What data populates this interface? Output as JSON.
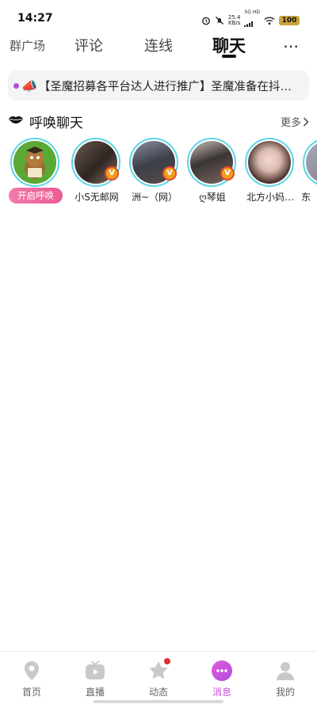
{
  "status_bar": {
    "time": "14:27",
    "speed_value": "25.4",
    "speed_unit": "KB/s",
    "network": "5G HD",
    "battery": "100"
  },
  "top_tabs": {
    "group_square": "群广场",
    "comments": "评论",
    "connect": "连线",
    "chat": "聊天",
    "active": "聊天"
  },
  "notice": {
    "text": "【圣魔招募各平台达人进行推广】圣魔准备在抖…"
  },
  "summon": {
    "title": "呼唤聊天",
    "more": "更多",
    "open_button": "开启呼唤",
    "users": [
      {
        "name": "小S无邮网",
        "vip": "V"
      },
      {
        "name": "洲~（网）",
        "vip": "V"
      },
      {
        "name": "ღ琴姐",
        "vip": "V"
      },
      {
        "name": "北方小妈…",
        "vip": ""
      },
      {
        "name": "东",
        "vip": ""
      }
    ]
  },
  "bottom_nav": {
    "items": [
      {
        "label": "首页",
        "icon": "location-pin-icon"
      },
      {
        "label": "直播",
        "icon": "tv-icon"
      },
      {
        "label": "动态",
        "icon": "star-icon"
      },
      {
        "label": "消息",
        "icon": "chat-bubble-icon"
      },
      {
        "label": "我的",
        "icon": "person-icon"
      }
    ],
    "active": "消息"
  },
  "colors": {
    "accent": "#c84fd6",
    "ring": "#5ad5e6",
    "summon_pink": "#ec5c94",
    "badge_red": "#e52d2d"
  }
}
